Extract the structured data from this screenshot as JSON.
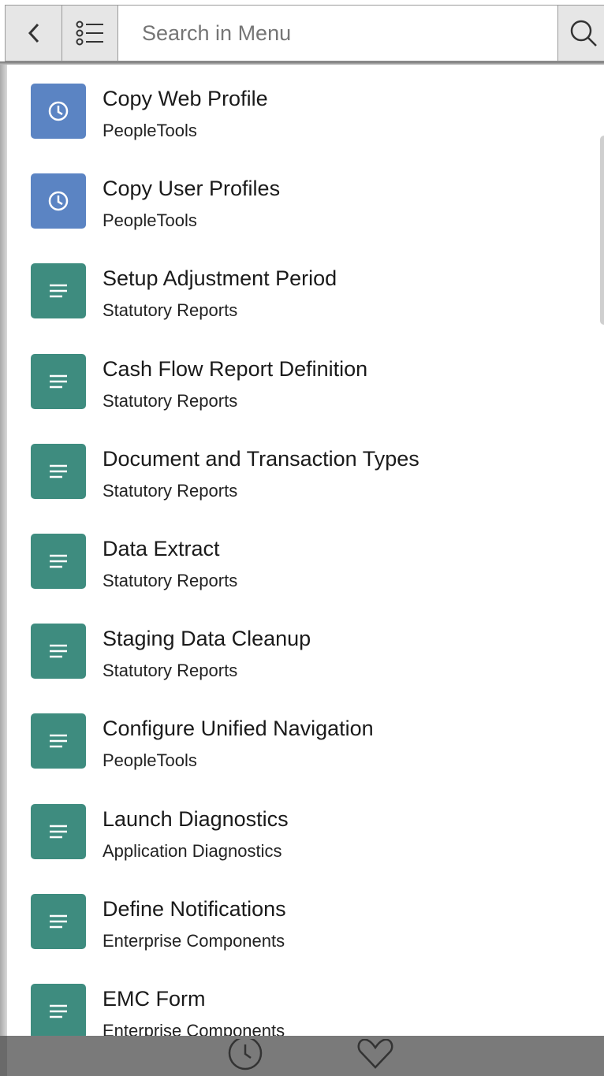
{
  "toolbar": {
    "back_icon": "chevron-left-icon",
    "list_icon": "list-icon",
    "search_placeholder": "Search in Menu",
    "search_value": "",
    "search_icon": "search-icon"
  },
  "menu": {
    "items": [
      {
        "title": "Copy Web Profile",
        "category": "PeopleTools",
        "icon": "clock-icon",
        "color": "#5b84c3"
      },
      {
        "title": "Copy User Profiles",
        "category": "PeopleTools",
        "icon": "clock-icon",
        "color": "#5b84c3"
      },
      {
        "title": "Setup Adjustment Period",
        "category": "Statutory Reports",
        "icon": "document-lines-icon",
        "color": "#3e8c7f"
      },
      {
        "title": "Cash Flow Report Definition",
        "category": "Statutory Reports",
        "icon": "document-lines-icon",
        "color": "#3e8c7f"
      },
      {
        "title": "Document and Transaction Types",
        "category": "Statutory Reports",
        "icon": "document-lines-icon",
        "color": "#3e8c7f"
      },
      {
        "title": "Data Extract",
        "category": "Statutory Reports",
        "icon": "document-lines-icon",
        "color": "#3e8c7f"
      },
      {
        "title": "Staging Data Cleanup",
        "category": "Statutory Reports",
        "icon": "document-lines-icon",
        "color": "#3e8c7f"
      },
      {
        "title": "Configure Unified Navigation",
        "category": "PeopleTools",
        "icon": "document-lines-icon",
        "color": "#3e8c7f"
      },
      {
        "title": "Launch Diagnostics",
        "category": "Application Diagnostics",
        "icon": "document-lines-icon",
        "color": "#3e8c7f"
      },
      {
        "title": "Define Notifications",
        "category": "Enterprise Components",
        "icon": "document-lines-icon",
        "color": "#3e8c7f"
      },
      {
        "title": "EMC Form",
        "category": "Enterprise Components",
        "icon": "document-lines-icon",
        "color": "#3e8c7f"
      }
    ]
  },
  "bottom_bar": {
    "recent_icon": "clock-icon",
    "favorites_icon": "heart-icon"
  }
}
